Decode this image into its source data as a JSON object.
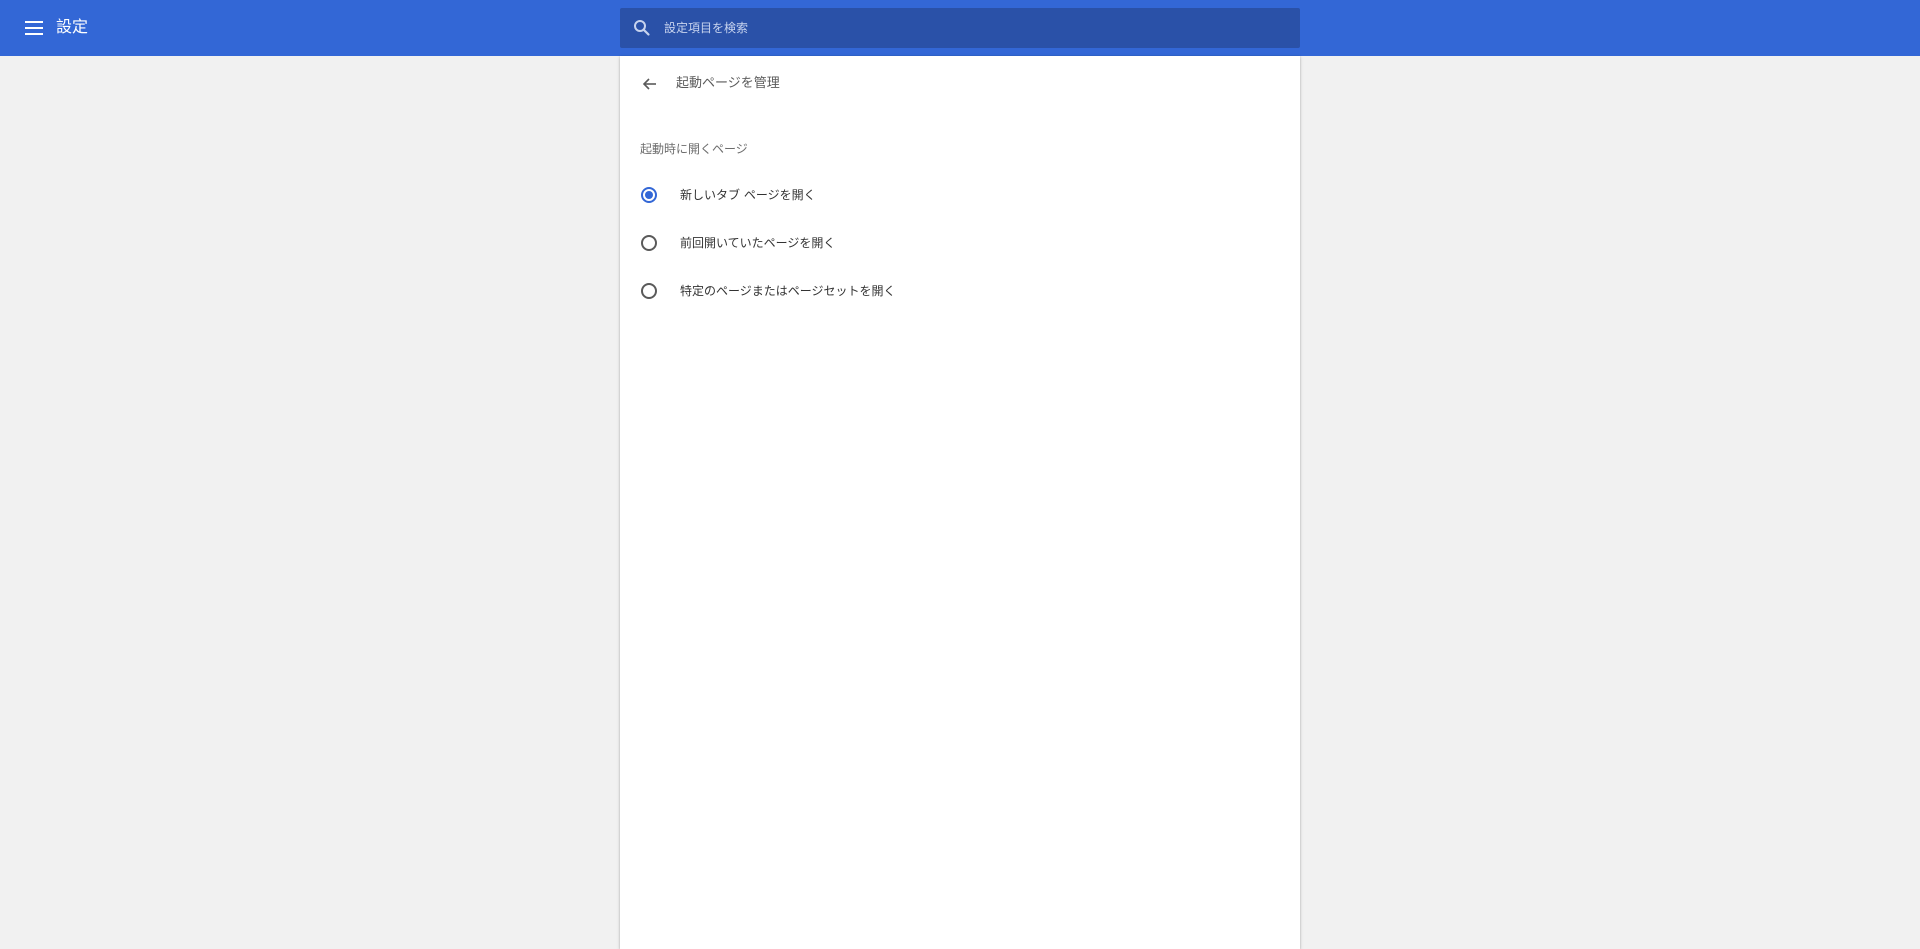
{
  "toolbar": {
    "title": "設定",
    "menu_icon": "hamburger-menu-icon",
    "search": {
      "icon": "search-icon",
      "placeholder": "設定項目を検索",
      "value": ""
    }
  },
  "subpage": {
    "back_icon": "arrow-back-icon",
    "title": "起動ページを管理",
    "section_label": "起動時に開くページ",
    "options": [
      {
        "label": "新しいタブ ページを開く",
        "checked": true
      },
      {
        "label": "前回開いていたページを開く",
        "checked": false
      },
      {
        "label": "特定のページまたはページセットを開く",
        "checked": false
      }
    ]
  },
  "colors": {
    "toolbar_bg": "#3367d6",
    "search_bg": "#2a51a8",
    "page_bg": "#f1f1f1",
    "accent": "#3367d6"
  }
}
